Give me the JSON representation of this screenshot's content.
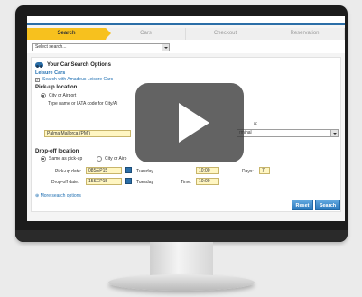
{
  "steps": [
    "Search",
    "Cars",
    "Checkout",
    "Reservation"
  ],
  "search_select": {
    "value": "Select search..."
  },
  "panel": {
    "title": "Your Car Search Options",
    "category": "Leisure Cars",
    "checkbox_label": "Search with Amadeus Leisure Cars",
    "checkbox_checked": true
  },
  "pickup": {
    "heading": "Pick-up location",
    "option_city": "City or Airport",
    "hint": "Type name or IATA code for City/Ai",
    "value": "Palma Mallorca (PMI)",
    "right_label": "a:",
    "right_select": "rminal"
  },
  "dropoff": {
    "heading": "Drop-off location",
    "option_same": "Same as pick-up",
    "option_city": "City or Airp",
    "pickup_date_label": "Pick-up date:",
    "pickup_date": "08SEP15",
    "pickup_day": "Tuesday",
    "pickup_time_value": "10:00",
    "days_label": "Days:",
    "days_value": "7",
    "dropoff_date_label": "Drop-off date:",
    "dropoff_date": "15SEP15",
    "dropoff_day": "Tuesday",
    "time_label": "Time:",
    "dropoff_time": "10:00"
  },
  "more_options": "More search options",
  "buttons": {
    "reset": "Reset",
    "search": "Search"
  },
  "colors": {
    "accent": "#2b6ea7",
    "active_step": "#f7c11e",
    "link": "#1f6fb2"
  }
}
